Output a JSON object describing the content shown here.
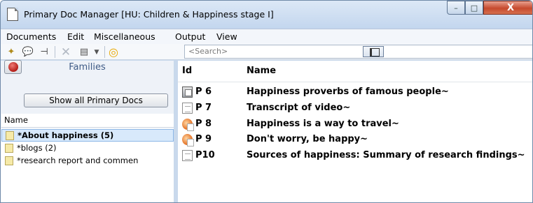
{
  "window": {
    "title": "Primary Doc Manager [HU: Children & Happiness stage I]",
    "minimize_glyph": "–",
    "maximize_glyph": "□",
    "close_glyph": "X"
  },
  "menu": [
    "Documents",
    "Edit",
    "Miscellaneous",
    "Output",
    "View"
  ],
  "toolbar": {
    "icons": [
      "new-document-icon",
      "comment-icon",
      "assign-icon",
      "delete-icon",
      "view-options-icon",
      "dropdown-icon",
      "filter-icon"
    ],
    "search_placeholder": "<Search>"
  },
  "families": {
    "title": "Families",
    "show_all_label": "Show all Primary Docs",
    "column_header": "Name",
    "items": [
      {
        "label": "*About happiness (5)",
        "selected": true
      },
      {
        "label": "*blogs (2)",
        "selected": false
      },
      {
        "label": "*research report and commen",
        "selected": false
      }
    ]
  },
  "docs": {
    "headers": {
      "id": "Id",
      "name": "Name"
    },
    "rows": [
      {
        "id": "P 6",
        "name": "Happiness proverbs of famous people~",
        "icon": "document-icon"
      },
      {
        "id": "P 7",
        "name": "Transcript of video~",
        "icon": "text-file-icon"
      },
      {
        "id": "P 8",
        "name": "Happiness is a way to travel~",
        "icon": "presentation-icon"
      },
      {
        "id": "P 9",
        "name": "Don't worry, be happy~",
        "icon": "presentation-icon"
      },
      {
        "id": "P10",
        "name": "Sources of happiness: Summary of research findings~",
        "icon": "text-file-icon"
      }
    ]
  },
  "colors": {
    "selected_bg": "#d8e9fb",
    "families_title": "#3f5b86",
    "close_button": "#c64a2e"
  }
}
